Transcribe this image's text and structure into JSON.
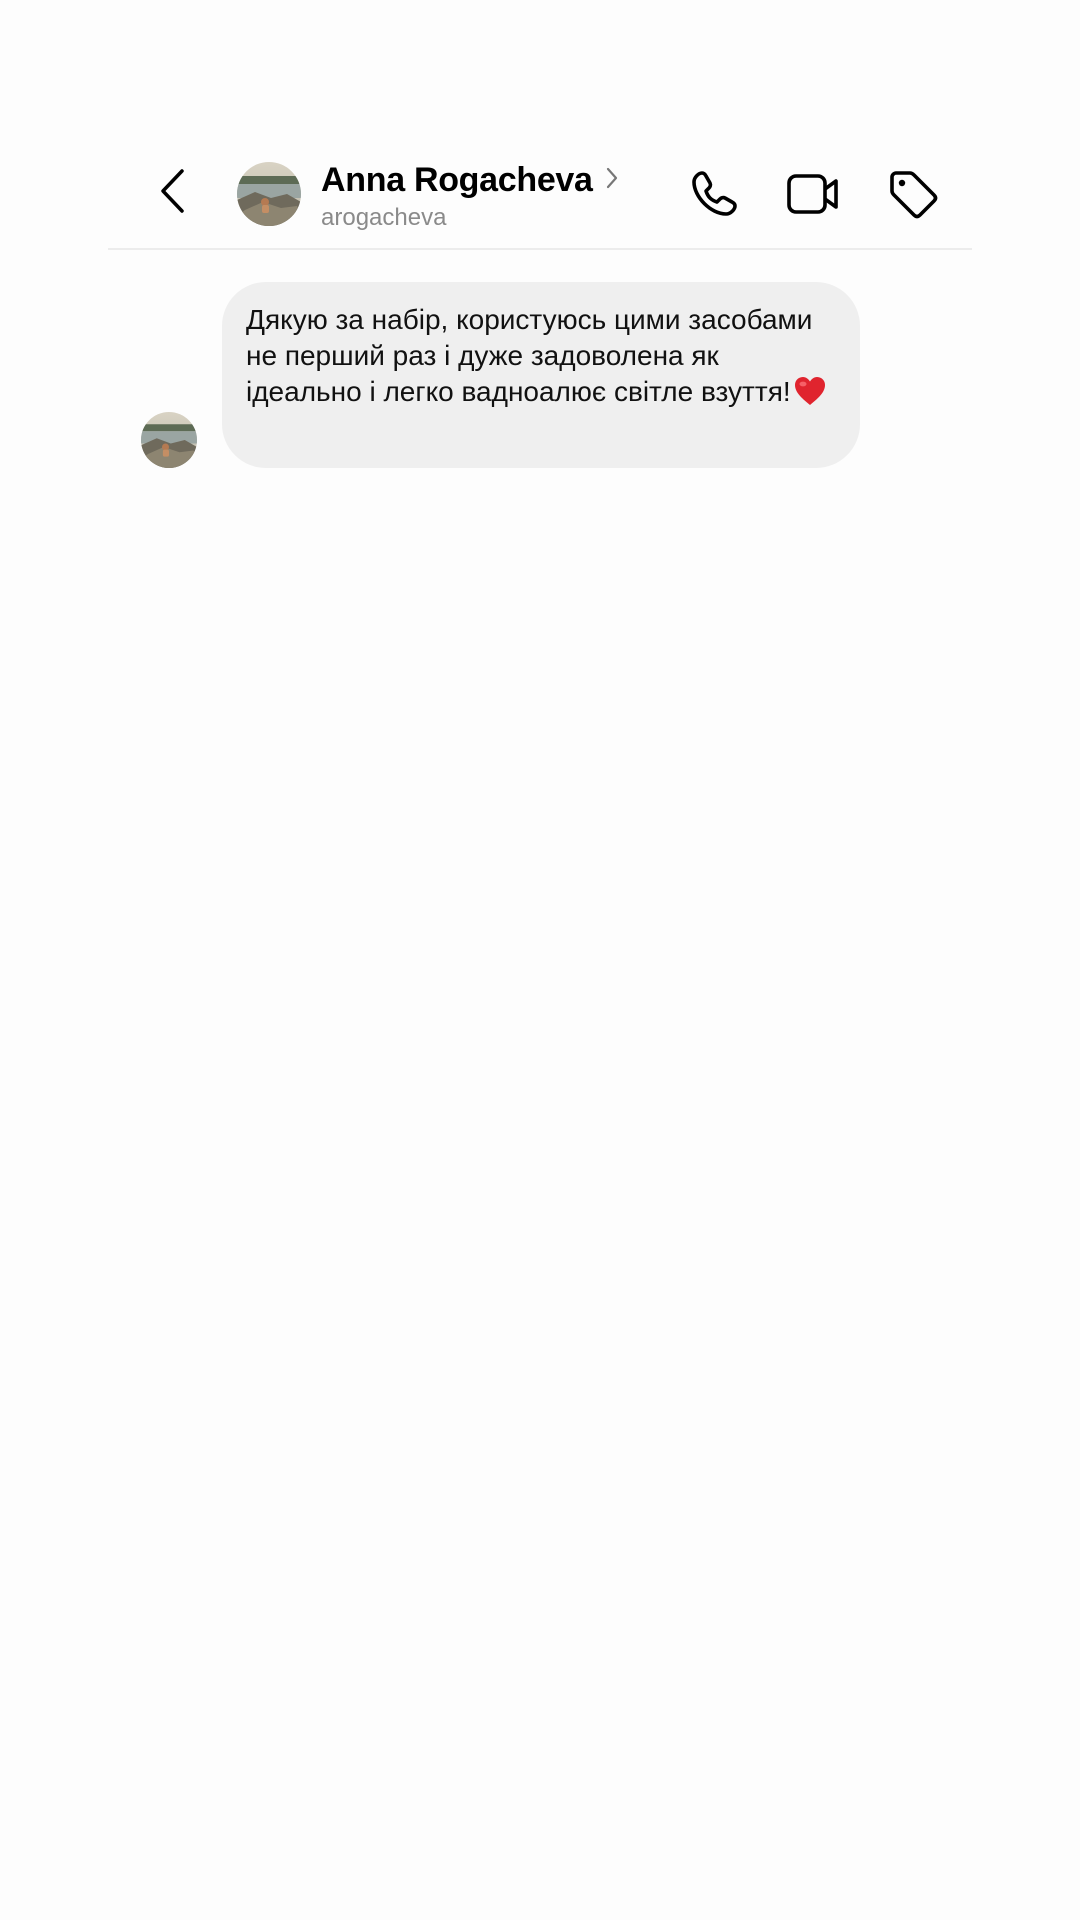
{
  "header": {
    "contact_name": "Anna Rogacheva",
    "contact_username": "arogacheva",
    "icons": {
      "back": "chevron-left-icon",
      "profile_chevron": "chevron-right-icon",
      "call": "phone-icon",
      "video": "video-camera-icon",
      "tag": "tag-icon"
    }
  },
  "messages": [
    {
      "sender": "Anna Rogacheva",
      "text": "Дякую за набір, користуюсь цими засобами не перший раз і дуже задоволена як ідеально і легко вадноалює світле взуття!",
      "emoji": "heart-emoji"
    }
  ],
  "colors": {
    "background": "#fdfdfd",
    "bubble_incoming": "#efefef",
    "secondary_text": "#8a8a8a",
    "divider": "#ececec",
    "heart": "#e0242e"
  }
}
